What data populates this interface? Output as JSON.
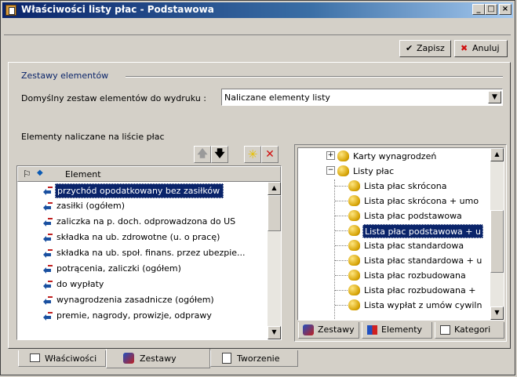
{
  "window": {
    "title": "Właściwości listy płac - Podstawowa",
    "minimize": "_",
    "maximize": "□",
    "close": "×"
  },
  "toolbar": {
    "save_label": "Zapisz",
    "cancel_label": "Anuluj"
  },
  "group": {
    "title": "Zestawy elementów"
  },
  "default_set": {
    "label": "Domyślny zestaw elementów do wydruku :",
    "value": "Naliczane elementy listy"
  },
  "elements": {
    "label": "Elementy naliczane na liście płac",
    "column_header": "Element",
    "rows": [
      "przychód opodatkowany bez zasiłków",
      "zasiłki (ogółem)",
      "zaliczka na p. doch. odprowadzona do US",
      "składka na ub. zdrowotne (u. o pracę)",
      "składka na ub. społ. finans. przez ubezpie...",
      "potrącenia, zaliczki (ogółem)",
      "do wypłaty",
      "wynagrodzenia zasadnicze (ogółem)",
      "premie, nagrody, prowizje, odprawy"
    ],
    "selected_index": 0
  },
  "tree": {
    "nodes": [
      {
        "label": "Karty wynagrodzeń",
        "level": 1,
        "expander": "+"
      },
      {
        "label": "Listy płac",
        "level": 1,
        "expander": "−"
      },
      {
        "label": "Lista płac skrócona",
        "level": 2
      },
      {
        "label": "Lista płac skrócona + umo",
        "level": 2
      },
      {
        "label": "Lista płac podstawowa",
        "level": 2
      },
      {
        "label": "Lista płac podstawowa + u",
        "level": 2,
        "selected": true
      },
      {
        "label": "Lista płac standardowa",
        "level": 2
      },
      {
        "label": "Lista płac standardowa + u",
        "level": 2
      },
      {
        "label": "Lista płac rozbudowana",
        "level": 2
      },
      {
        "label": "Lista płac rozbudowana +",
        "level": 2
      },
      {
        "label": "Lista wypłat z umów cywiln",
        "level": 2
      }
    ],
    "tabs": [
      "Zestawy",
      "Elementy",
      "Kategori"
    ]
  },
  "bottom_tabs": [
    "Właściwości",
    "Zestawy",
    "Tworzenie"
  ],
  "colors": {
    "title_start": "#0a246a",
    "title_end": "#a6caf0",
    "selection": "#0a246a",
    "face": "#d4d0c8"
  }
}
